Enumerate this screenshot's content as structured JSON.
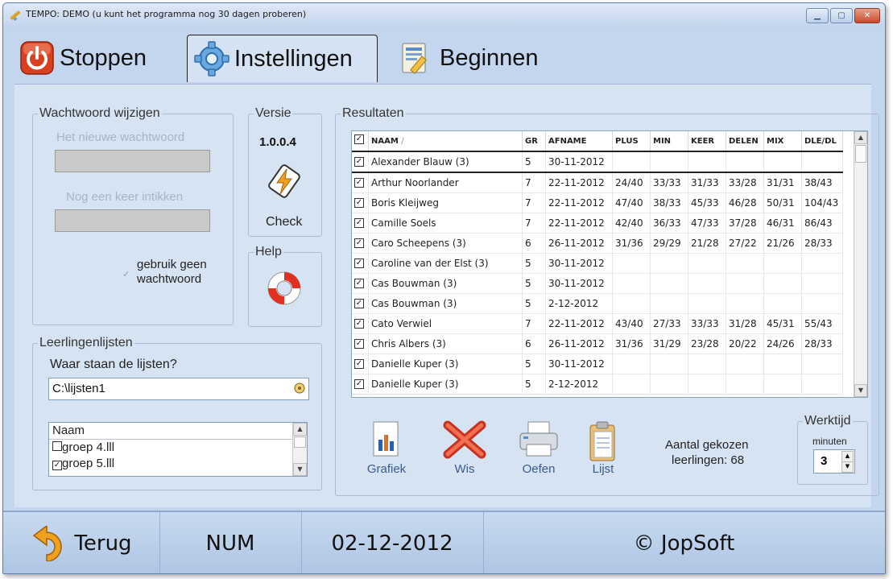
{
  "window": {
    "title": "TEMPO: DEMO (u kunt het programma nog 30 dagen proberen)"
  },
  "tabs": [
    {
      "label": "Stoppen",
      "icon": "power-icon"
    },
    {
      "label": "Instellingen",
      "icon": "gear-icon"
    },
    {
      "label": "Beginnen",
      "icon": "calculator-notepad-icon"
    }
  ],
  "password": {
    "legend": "Wachtwoord wijzigen",
    "new_label": "Het nieuwe wachtwoord",
    "new_value": "",
    "repeat_label": "Nog een keer intikken",
    "repeat_value": "",
    "no_password_label_1": "gebruik geen",
    "no_password_label_2": "wachtwoord",
    "no_password_checked": true
  },
  "version": {
    "legend": "Versie",
    "number": "1.0.0.4",
    "check_label": "Check"
  },
  "help": {
    "legend": "Help"
  },
  "lists": {
    "legend": "Leerlingenlijsten",
    "question": "Waar staan de lijsten?",
    "path": "C:\\lijsten1",
    "column": "Naam",
    "items": [
      {
        "label": "groep 4.lll",
        "checked": false
      },
      {
        "label": "groep 5.lll",
        "checked": true
      }
    ]
  },
  "results": {
    "legend": "Resultaten",
    "columns": [
      "NAAM",
      "GR",
      "AFNAME",
      "PLUS",
      "MIN",
      "KEER",
      "DELEN",
      "MIX",
      "DLE/DL"
    ],
    "sort_marker": "/",
    "rows": [
      {
        "name": "Alexander Blauw (3)",
        "gr": "5",
        "afname": "30-11-2012",
        "plus": "",
        "min": "",
        "keer": "",
        "delen": "",
        "mix": "",
        "dle": ""
      },
      {
        "name": "Arthur Noorlander",
        "gr": "7",
        "afname": "22-11-2012",
        "plus": "24/40",
        "min": "33/33",
        "keer": "31/33",
        "delen": "33/28",
        "mix": "31/31",
        "dle": "38/43"
      },
      {
        "name": "Boris Kleijweg",
        "gr": "7",
        "afname": "22-11-2012",
        "plus": "47/40",
        "min": "38/33",
        "keer": "45/33",
        "delen": "46/28",
        "mix": "50/31",
        "dle": "104/43"
      },
      {
        "name": "Camille Soels",
        "gr": "7",
        "afname": "22-11-2012",
        "plus": "42/40",
        "min": "36/33",
        "keer": "47/33",
        "delen": "37/28",
        "mix": "46/31",
        "dle": "86/43"
      },
      {
        "name": "Caro Scheepens (3)",
        "gr": "6",
        "afname": "26-11-2012",
        "plus": "31/36",
        "min": "29/29",
        "keer": "21/28",
        "delen": "27/22",
        "mix": "21/26",
        "dle": "28/33"
      },
      {
        "name": "Caroline van der Elst (3)",
        "gr": "5",
        "afname": "30-11-2012",
        "plus": "",
        "min": "",
        "keer": "",
        "delen": "",
        "mix": "",
        "dle": ""
      },
      {
        "name": "Cas Bouwman (3)",
        "gr": "5",
        "afname": "30-11-2012",
        "plus": "",
        "min": "",
        "keer": "",
        "delen": "",
        "mix": "",
        "dle": ""
      },
      {
        "name": "Cas Bouwman (3)",
        "gr": "5",
        "afname": "2-12-2012",
        "plus": "",
        "min": "",
        "keer": "",
        "delen": "",
        "mix": "",
        "dle": ""
      },
      {
        "name": "Cato Verwiel",
        "gr": "7",
        "afname": "22-11-2012",
        "plus": "43/40",
        "min": "27/33",
        "keer": "33/33",
        "delen": "31/28",
        "mix": "45/31",
        "dle": "55/43"
      },
      {
        "name": "Chris Albers (3)",
        "gr": "6",
        "afname": "26-11-2012",
        "plus": "31/36",
        "min": "31/29",
        "keer": "23/28",
        "delen": "20/22",
        "mix": "24/26",
        "dle": "28/33"
      },
      {
        "name": "Danielle Kuper (3)",
        "gr": "5",
        "afname": "30-11-2012",
        "plus": "",
        "min": "",
        "keer": "",
        "delen": "",
        "mix": "",
        "dle": ""
      },
      {
        "name": "Danielle Kuper (3)",
        "gr": "5",
        "afname": "2-12-2012",
        "plus": "",
        "min": "",
        "keer": "",
        "delen": "",
        "mix": "",
        "dle": ""
      }
    ]
  },
  "actions": {
    "grafiek": "Grafiek",
    "wis": "Wis",
    "oefen": "Oefen",
    "lijst": "Lijst"
  },
  "count": {
    "line1": "Aantal gekozen",
    "line2": "leerlingen: 68"
  },
  "worktime": {
    "legend": "Werktijd",
    "unit": "minuten",
    "value": "3"
  },
  "status": {
    "back": "Terug",
    "num": "NUM",
    "date": "02-12-2012",
    "copyright": "© JopSoft"
  },
  "colors": {
    "accent_blue": "#c4d6ee",
    "panel": "#d6e3f3",
    "link_blue": "#3a5b8a"
  }
}
